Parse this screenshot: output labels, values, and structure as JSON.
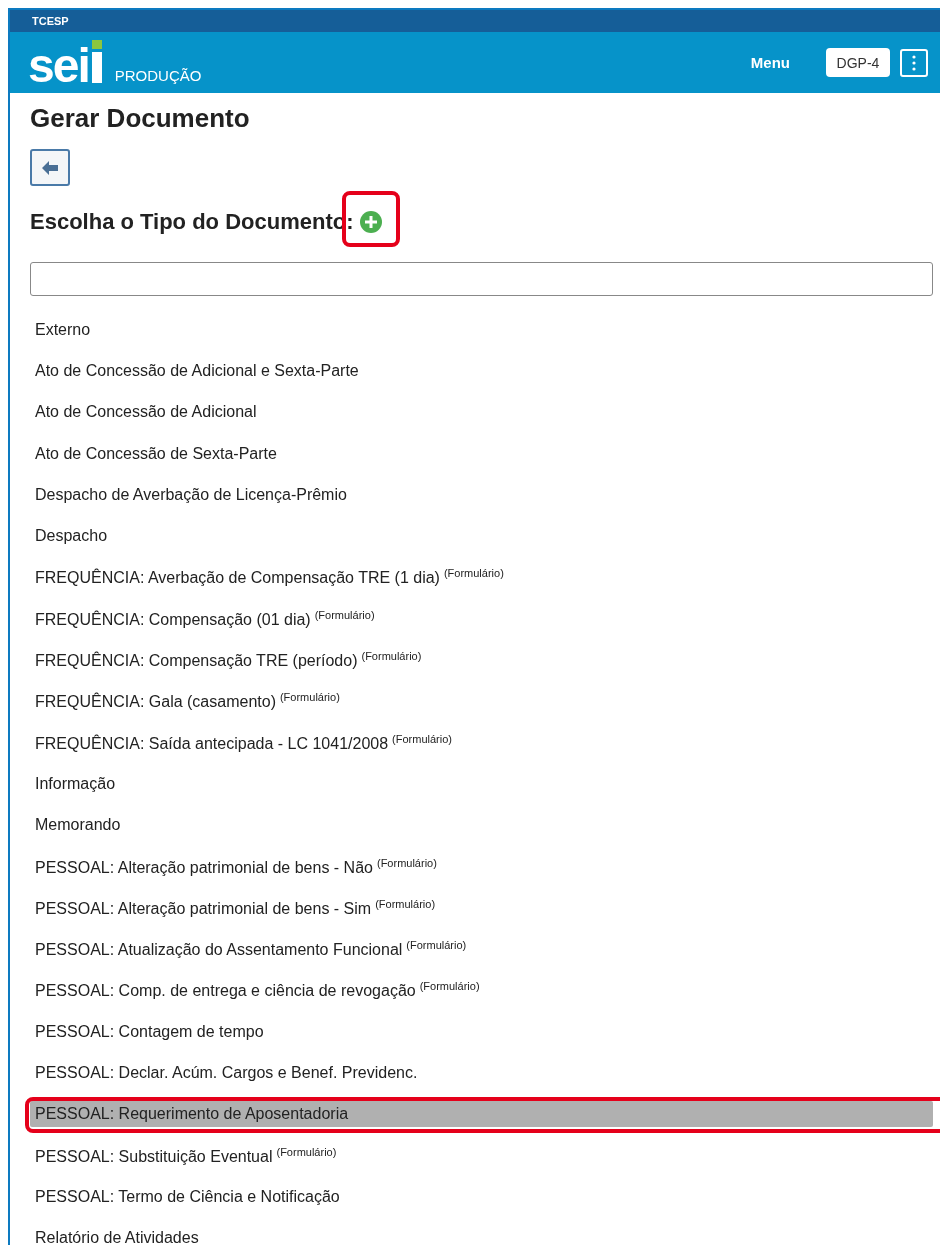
{
  "org_bar": {
    "label": "TCESP"
  },
  "header": {
    "logo": "sei",
    "environment": "PRODUÇÃO",
    "menu": "Menu",
    "unit": "DGP-4"
  },
  "page": {
    "title": "Gerar Documento",
    "section_title": "Escolha o Tipo do Documento:"
  },
  "document_types": [
    {
      "label": "Externo",
      "selected": false
    },
    {
      "label": "Ato de Concessão de Adicional e Sexta-Parte",
      "selected": false
    },
    {
      "label": "Ato de Concessão de Adicional",
      "selected": false
    },
    {
      "label": "Ato de Concessão de Sexta-Parte",
      "selected": false
    },
    {
      "label": "Despacho de Averbação de Licença-Prêmio",
      "selected": false
    },
    {
      "label": "Despacho",
      "selected": false
    },
    {
      "label": "FREQUÊNCIA: Averbação de Compensação TRE (1 dia)",
      "note": "(Formulário)",
      "selected": false
    },
    {
      "label": "FREQUÊNCIA: Compensação (01 dia)",
      "note": "(Formulário)",
      "selected": false
    },
    {
      "label": "FREQUÊNCIA: Compensação TRE (período)",
      "note": "(Formulário)",
      "selected": false
    },
    {
      "label": "FREQUÊNCIA: Gala (casamento)",
      "note": "(Formulário)",
      "selected": false
    },
    {
      "label": "FREQUÊNCIA: Saída antecipada - LC 1041/2008",
      "note": "(Formulário)",
      "selected": false
    },
    {
      "label": "Informação",
      "selected": false
    },
    {
      "label": "Memorando",
      "selected": false
    },
    {
      "label": "PESSOAL: Alteração patrimonial de bens - Não",
      "note": "(Formulário)",
      "selected": false
    },
    {
      "label": "PESSOAL: Alteração patrimonial de bens - Sim",
      "note": "(Formulário)",
      "selected": false
    },
    {
      "label": "PESSOAL: Atualização do Assentamento Funcional",
      "note": "(Formulário)",
      "selected": false
    },
    {
      "label": "PESSOAL: Comp. de entrega e ciência de revogação",
      "note": "(Formulário)",
      "selected": false
    },
    {
      "label": "PESSOAL: Contagem de tempo",
      "selected": false
    },
    {
      "label": "PESSOAL: Declar. Acúm. Cargos e Benef. Previdenc.",
      "selected": false
    },
    {
      "label": "PESSOAL: Requerimento de Aposentadoria",
      "selected": true
    },
    {
      "label": "PESSOAL: Substituição Eventual",
      "note": "(Formulário)",
      "selected": false
    },
    {
      "label": "PESSOAL: Termo de Ciência e Notificação",
      "selected": false
    },
    {
      "label": "Relatório de Atividades",
      "selected": false
    }
  ]
}
